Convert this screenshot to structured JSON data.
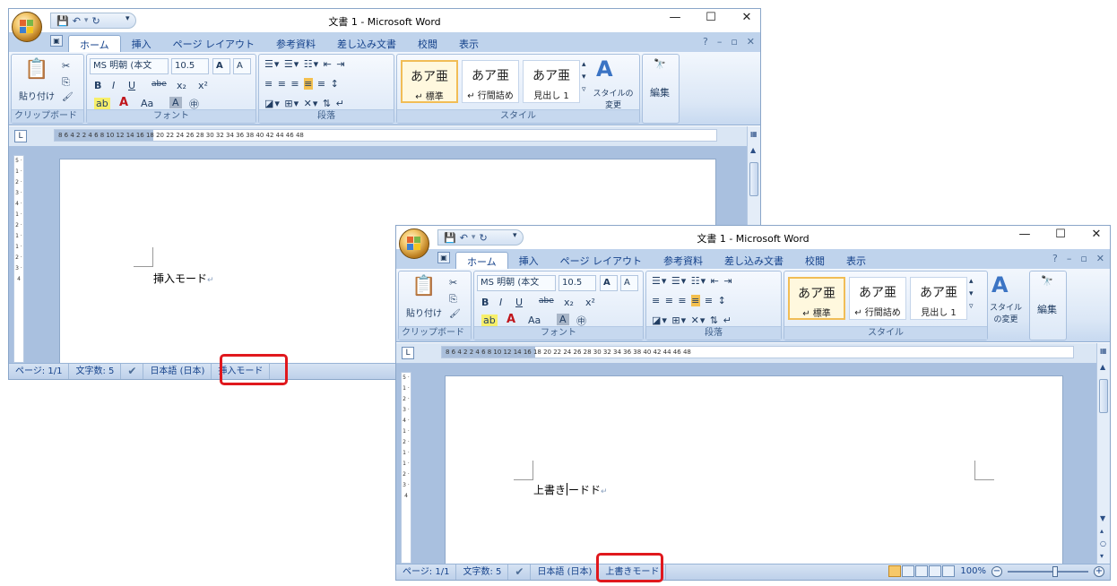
{
  "app": {
    "title": "文書 1 - Microsoft Word",
    "win_minimize": "—",
    "win_maximize": "☐",
    "win_close": "✕",
    "help": "?",
    "doc_minimize": "–",
    "doc_restore": "▫",
    "doc_close": "✕"
  },
  "qat": {
    "save": "💾",
    "undo": "↶",
    "undo_drop": "▾",
    "redo": "↻",
    "customize": "▾"
  },
  "tabs": [
    "ホーム",
    "挿入",
    "ページ レイアウト",
    "参考資料",
    "差し込み文書",
    "校閲",
    "表示"
  ],
  "ribbon": {
    "clipboard": {
      "paste": "貼り付け",
      "cut": "✂",
      "copy": "⎘",
      "format_painter": "🖌",
      "label": "クリップボード"
    },
    "font": {
      "font_name": "MS 明朝 (本文",
      "font_size": "10.5",
      "grow": "A",
      "shrink": "A",
      "bold": "B",
      "italic": "I",
      "underline": "U",
      "strike": "abe",
      "sub": "x₂",
      "sup": "x²",
      "highlight": "ab",
      "color": "A",
      "case": "Aa",
      "char_shading": "A",
      "enclose": "㊥",
      "label": "フォント"
    },
    "paragraph": {
      "label": "段落"
    },
    "styles": {
      "items": [
        {
          "sample": "あア亜",
          "name": "↵ 標準"
        },
        {
          "sample": "あア亜",
          "name": "↵ 行間詰め"
        },
        {
          "sample": "あア亜",
          "name": "見出し 1"
        }
      ],
      "change_styles": "スタイルの変更",
      "label": "スタイル"
    },
    "editing": {
      "label": "編集",
      "icon": "🔭"
    }
  },
  "ruler": {
    "ticks": "8   6   4   2       2    4    6    8    10   12   14   16   18   20   22   24   26   28   30   32   34   36   38   40   42   44   46   48"
  },
  "vruler": {
    "ticks": "5 · 1 · 2 · 3 · 4 · 1 · 2 · 1 · 1 · 2 · 3 · 4"
  },
  "left_window": {
    "doc_text": "挿入モード",
    "para_mark": "↵",
    "status": {
      "page": "ページ: 1/1",
      "words": "文字数: 5",
      "lang": "日本語 (日本)",
      "mode": "挿入モード"
    }
  },
  "right_window": {
    "doc_text_before": "上書き",
    "doc_text_after": "ードド",
    "para_mark": "↵",
    "status": {
      "page": "ページ: 1/1",
      "words": "文字数: 5",
      "lang": "日本語 (日本)",
      "mode": "上書きモード",
      "zoom": "100%"
    }
  },
  "colors": {
    "highlight_box": "#e0181d",
    "ribbon": "#dbe7f6",
    "status": "#bdd0ea"
  }
}
